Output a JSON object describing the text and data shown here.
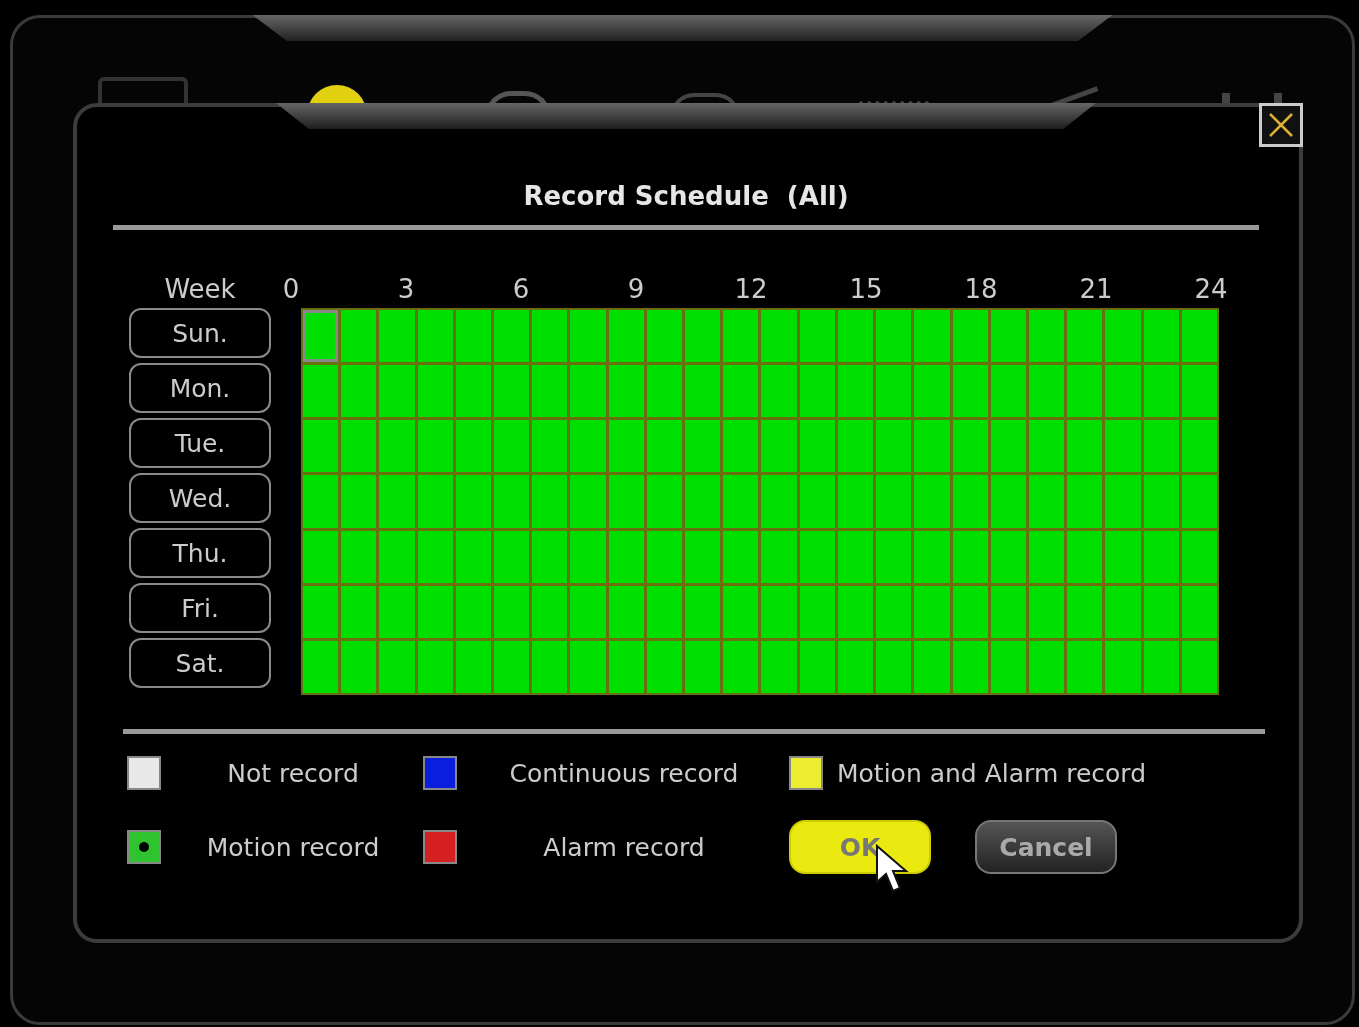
{
  "dialog": {
    "title": "Record Schedule  (All)"
  },
  "week_label": "Week",
  "hour_labels": [
    "0",
    "3",
    "6",
    "9",
    "12",
    "15",
    "18",
    "21",
    "24"
  ],
  "days": [
    {
      "label": "Sun.",
      "cells": [
        {
          "color": "#00e000",
          "focused": true
        },
        {
          "color": "#00e000",
          "focused": false
        },
        {
          "color": "#00e000",
          "focused": false
        },
        {
          "color": "#00e000",
          "focused": false
        },
        {
          "color": "#00e000",
          "focused": false
        },
        {
          "color": "#00e000",
          "focused": false
        },
        {
          "color": "#00e000",
          "focused": false
        },
        {
          "color": "#00e000",
          "focused": false
        },
        {
          "color": "#00e000",
          "focused": false
        },
        {
          "color": "#00e000",
          "focused": false
        },
        {
          "color": "#00e000",
          "focused": false
        },
        {
          "color": "#00e000",
          "focused": false
        },
        {
          "color": "#00e000",
          "focused": false
        },
        {
          "color": "#00e000",
          "focused": false
        },
        {
          "color": "#00e000",
          "focused": false
        },
        {
          "color": "#00e000",
          "focused": false
        },
        {
          "color": "#00e000",
          "focused": false
        },
        {
          "color": "#00e000",
          "focused": false
        },
        {
          "color": "#00e000",
          "focused": false
        },
        {
          "color": "#00e000",
          "focused": false
        },
        {
          "color": "#00e000",
          "focused": false
        },
        {
          "color": "#00e000",
          "focused": false
        },
        {
          "color": "#00e000",
          "focused": false
        },
        {
          "color": "#00e000",
          "focused": false
        }
      ]
    },
    {
      "label": "Mon.",
      "cells": [
        {
          "color": "#00e000",
          "focused": false
        },
        {
          "color": "#00e000",
          "focused": false
        },
        {
          "color": "#00e000",
          "focused": false
        },
        {
          "color": "#00e000",
          "focused": false
        },
        {
          "color": "#00e000",
          "focused": false
        },
        {
          "color": "#00e000",
          "focused": false
        },
        {
          "color": "#00e000",
          "focused": false
        },
        {
          "color": "#00e000",
          "focused": false
        },
        {
          "color": "#00e000",
          "focused": false
        },
        {
          "color": "#00e000",
          "focused": false
        },
        {
          "color": "#00e000",
          "focused": false
        },
        {
          "color": "#00e000",
          "focused": false
        },
        {
          "color": "#00e000",
          "focused": false
        },
        {
          "color": "#00e000",
          "focused": false
        },
        {
          "color": "#00e000",
          "focused": false
        },
        {
          "color": "#00e000",
          "focused": false
        },
        {
          "color": "#00e000",
          "focused": false
        },
        {
          "color": "#00e000",
          "focused": false
        },
        {
          "color": "#00e000",
          "focused": false
        },
        {
          "color": "#00e000",
          "focused": false
        },
        {
          "color": "#00e000",
          "focused": false
        },
        {
          "color": "#00e000",
          "focused": false
        },
        {
          "color": "#00e000",
          "focused": false
        },
        {
          "color": "#00e000",
          "focused": false
        }
      ]
    },
    {
      "label": "Tue.",
      "cells": [
        {
          "color": "#00e000",
          "focused": false
        },
        {
          "color": "#00e000",
          "focused": false
        },
        {
          "color": "#00e000",
          "focused": false
        },
        {
          "color": "#00e000",
          "focused": false
        },
        {
          "color": "#00e000",
          "focused": false
        },
        {
          "color": "#00e000",
          "focused": false
        },
        {
          "color": "#00e000",
          "focused": false
        },
        {
          "color": "#00e000",
          "focused": false
        },
        {
          "color": "#00e000",
          "focused": false
        },
        {
          "color": "#00e000",
          "focused": false
        },
        {
          "color": "#00e000",
          "focused": false
        },
        {
          "color": "#00e000",
          "focused": false
        },
        {
          "color": "#00e000",
          "focused": false
        },
        {
          "color": "#00e000",
          "focused": false
        },
        {
          "color": "#00e000",
          "focused": false
        },
        {
          "color": "#00e000",
          "focused": false
        },
        {
          "color": "#00e000",
          "focused": false
        },
        {
          "color": "#00e000",
          "focused": false
        },
        {
          "color": "#00e000",
          "focused": false
        },
        {
          "color": "#00e000",
          "focused": false
        },
        {
          "color": "#00e000",
          "focused": false
        },
        {
          "color": "#00e000",
          "focused": false
        },
        {
          "color": "#00e000",
          "focused": false
        },
        {
          "color": "#00e000",
          "focused": false
        }
      ]
    },
    {
      "label": "Wed.",
      "cells": [
        {
          "color": "#00e000",
          "focused": false
        },
        {
          "color": "#00e000",
          "focused": false
        },
        {
          "color": "#00e000",
          "focused": false
        },
        {
          "color": "#00e000",
          "focused": false
        },
        {
          "color": "#00e000",
          "focused": false
        },
        {
          "color": "#00e000",
          "focused": false
        },
        {
          "color": "#00e000",
          "focused": false
        },
        {
          "color": "#00e000",
          "focused": false
        },
        {
          "color": "#00e000",
          "focused": false
        },
        {
          "color": "#00e000",
          "focused": false
        },
        {
          "color": "#00e000",
          "focused": false
        },
        {
          "color": "#00e000",
          "focused": false
        },
        {
          "color": "#00e000",
          "focused": false
        },
        {
          "color": "#00e000",
          "focused": false
        },
        {
          "color": "#00e000",
          "focused": false
        },
        {
          "color": "#00e000",
          "focused": false
        },
        {
          "color": "#00e000",
          "focused": false
        },
        {
          "color": "#00e000",
          "focused": false
        },
        {
          "color": "#00e000",
          "focused": false
        },
        {
          "color": "#00e000",
          "focused": false
        },
        {
          "color": "#00e000",
          "focused": false
        },
        {
          "color": "#00e000",
          "focused": false
        },
        {
          "color": "#00e000",
          "focused": false
        },
        {
          "color": "#00e000",
          "focused": false
        }
      ]
    },
    {
      "label": "Thu.",
      "cells": [
        {
          "color": "#00e000",
          "focused": false
        },
        {
          "color": "#00e000",
          "focused": false
        },
        {
          "color": "#00e000",
          "focused": false
        },
        {
          "color": "#00e000",
          "focused": false
        },
        {
          "color": "#00e000",
          "focused": false
        },
        {
          "color": "#00e000",
          "focused": false
        },
        {
          "color": "#00e000",
          "focused": false
        },
        {
          "color": "#00e000",
          "focused": false
        },
        {
          "color": "#00e000",
          "focused": false
        },
        {
          "color": "#00e000",
          "focused": false
        },
        {
          "color": "#00e000",
          "focused": false
        },
        {
          "color": "#00e000",
          "focused": false
        },
        {
          "color": "#00e000",
          "focused": false
        },
        {
          "color": "#00e000",
          "focused": false
        },
        {
          "color": "#00e000",
          "focused": false
        },
        {
          "color": "#00e000",
          "focused": false
        },
        {
          "color": "#00e000",
          "focused": false
        },
        {
          "color": "#00e000",
          "focused": false
        },
        {
          "color": "#00e000",
          "focused": false
        },
        {
          "color": "#00e000",
          "focused": false
        },
        {
          "color": "#00e000",
          "focused": false
        },
        {
          "color": "#00e000",
          "focused": false
        },
        {
          "color": "#00e000",
          "focused": false
        },
        {
          "color": "#00e000",
          "focused": false
        }
      ]
    },
    {
      "label": "Fri.",
      "cells": [
        {
          "color": "#00e000",
          "focused": false
        },
        {
          "color": "#00e000",
          "focused": false
        },
        {
          "color": "#00e000",
          "focused": false
        },
        {
          "color": "#00e000",
          "focused": false
        },
        {
          "color": "#00e000",
          "focused": false
        },
        {
          "color": "#00e000",
          "focused": false
        },
        {
          "color": "#00e000",
          "focused": false
        },
        {
          "color": "#00e000",
          "focused": false
        },
        {
          "color": "#00e000",
          "focused": false
        },
        {
          "color": "#00e000",
          "focused": false
        },
        {
          "color": "#00e000",
          "focused": false
        },
        {
          "color": "#00e000",
          "focused": false
        },
        {
          "color": "#00e000",
          "focused": false
        },
        {
          "color": "#00e000",
          "focused": false
        },
        {
          "color": "#00e000",
          "focused": false
        },
        {
          "color": "#00e000",
          "focused": false
        },
        {
          "color": "#00e000",
          "focused": false
        },
        {
          "color": "#00e000",
          "focused": false
        },
        {
          "color": "#00e000",
          "focused": false
        },
        {
          "color": "#00e000",
          "focused": false
        },
        {
          "color": "#00e000",
          "focused": false
        },
        {
          "color": "#00e000",
          "focused": false
        },
        {
          "color": "#00e000",
          "focused": false
        },
        {
          "color": "#00e000",
          "focused": false
        }
      ]
    },
    {
      "label": "Sat.",
      "cells": [
        {
          "color": "#00e000",
          "focused": false
        },
        {
          "color": "#00e000",
          "focused": false
        },
        {
          "color": "#00e000",
          "focused": false
        },
        {
          "color": "#00e000",
          "focused": false
        },
        {
          "color": "#00e000",
          "focused": false
        },
        {
          "color": "#00e000",
          "focused": false
        },
        {
          "color": "#00e000",
          "focused": false
        },
        {
          "color": "#00e000",
          "focused": false
        },
        {
          "color": "#00e000",
          "focused": false
        },
        {
          "color": "#00e000",
          "focused": false
        },
        {
          "color": "#00e000",
          "focused": false
        },
        {
          "color": "#00e000",
          "focused": false
        },
        {
          "color": "#00e000",
          "focused": false
        },
        {
          "color": "#00e000",
          "focused": false
        },
        {
          "color": "#00e000",
          "focused": false
        },
        {
          "color": "#00e000",
          "focused": false
        },
        {
          "color": "#00e000",
          "focused": false
        },
        {
          "color": "#00e000",
          "focused": false
        },
        {
          "color": "#00e000",
          "focused": false
        },
        {
          "color": "#00e000",
          "focused": false
        },
        {
          "color": "#00e000",
          "focused": false
        },
        {
          "color": "#00e000",
          "focused": false
        },
        {
          "color": "#00e000",
          "focused": false
        },
        {
          "color": "#00e000",
          "focused": false
        }
      ]
    }
  ],
  "legend": [
    {
      "label": "Not record",
      "color": "#e8e8e8",
      "selected": false
    },
    {
      "label": "Continuous record",
      "color": "#0a1ee0",
      "selected": false
    },
    {
      "label": "Motion and Alarm record",
      "color": "#ecec30",
      "selected": false
    },
    {
      "label": "Motion record",
      "color": "#2fc42f",
      "selected": true
    },
    {
      "label": "Alarm record",
      "color": "#d42020",
      "selected": false
    }
  ],
  "buttons": [
    {
      "kind": "ok",
      "label": "OK"
    },
    {
      "kind": "cancel",
      "label": "Cancel"
    }
  ]
}
